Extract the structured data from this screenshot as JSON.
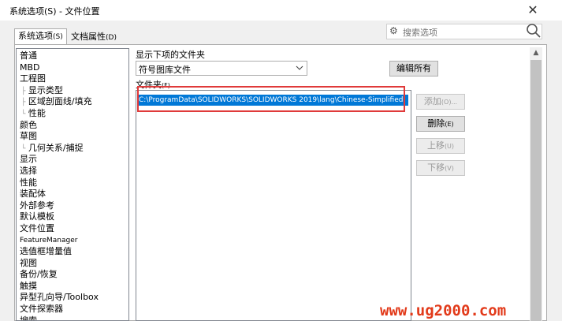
{
  "window": {
    "title": "系统选项(S) - 文件位置",
    "close_glyph": "✕"
  },
  "tabs": [
    {
      "label": "系统选项",
      "hotkey": "(S)"
    },
    {
      "label": "文档属性",
      "hotkey": "(D)"
    }
  ],
  "search": {
    "placeholder": "搜索选项"
  },
  "tree": {
    "items": [
      "普通",
      "MBD",
      "工程图",
      "显示类型",
      "区域剖面线/填充",
      "性能",
      "颜色",
      "草图",
      "几何关系/捕捉",
      "显示",
      "选择",
      "性能",
      "装配体",
      "外部参考",
      "默认模板",
      "文件位置",
      "FeatureManager",
      "选值框增量值",
      "视图",
      "备份/恢复",
      "触摸",
      "异型孔向导/Toolbox",
      "文件探索器",
      "搜索"
    ]
  },
  "folders": {
    "show_label": "显示下项的文件夹",
    "selected_value": "符号图库文件",
    "folder_label": "文件夹",
    "folder_hotkey": "(F)",
    "entries": [
      "C:\\ProgramData\\SOLIDWORKS\\SOLIDWORKS 2019\\lang\\Chinese-Simplified"
    ]
  },
  "buttons": {
    "edit_all": "编辑所有",
    "add": "添加",
    "add_hotkey": "(O)...",
    "delete": "删除",
    "delete_hotkey": "(E)",
    "move_up": "上移",
    "move_up_hotkey": "(U)",
    "move_down": "下移",
    "move_down_hotkey": "(V)"
  },
  "watermark": "www.ug2000.com",
  "colors": {
    "selection": "#0078d7",
    "annotation_box": "#e03a3a",
    "watermark": "#e23a1a"
  }
}
